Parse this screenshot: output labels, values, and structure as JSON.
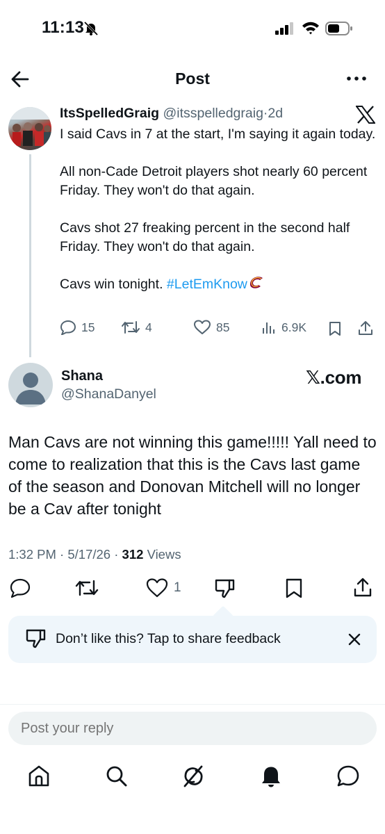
{
  "status_bar": {
    "time": "11:13"
  },
  "header": {
    "title": "Post"
  },
  "quoted_post": {
    "author_name": "ItsSpelledGraig",
    "author_handle": "@itsspelledgraig",
    "age": "2d",
    "paragraphs": [
      "I said Cavs in 7 at the start, I'm saying it again today.",
      "All non-Cade Detroit players shot nearly 60 percent Friday. They won't do that again.",
      "Cavs shot 27 freaking percent in the second half Friday. They won't do that again."
    ],
    "last_line_text": "Cavs win tonight. ",
    "hashtag": "#LetEmKnow",
    "stats": {
      "replies": "15",
      "reposts": "4",
      "likes": "85",
      "views": "6.9K"
    }
  },
  "main_post": {
    "author_name": "Shana",
    "author_handle": "@ShanaDanyel",
    "source_logo": "𝕏.com",
    "body": "Man Cavs are not winning this game!!!!! Yall need to come to realization that this is the Cavs last game of the season and Donovan Mitchell will no longer be a Cav after tonight",
    "time": "1:32 PM",
    "date": "5/17/26",
    "views_count": "312",
    "views_label": "Views",
    "likes": "1"
  },
  "feedback": {
    "text": "Don’t like this? Tap to share feedback"
  },
  "reply": {
    "placeholder": "Post your reply"
  },
  "colors": {
    "accent": "#1d9bf0",
    "text_primary": "#0f1419",
    "text_secondary": "#536471",
    "cavs_wine": "#860038",
    "cavs_gold": "#fdbb30"
  }
}
